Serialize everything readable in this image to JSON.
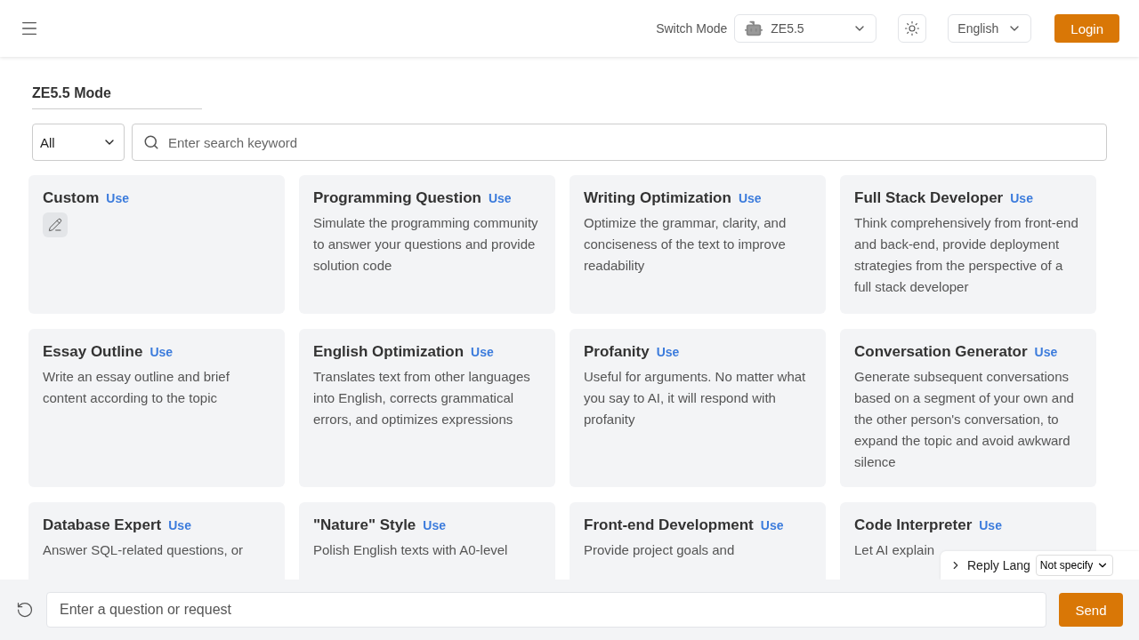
{
  "header": {
    "switch_label": "Switch Mode",
    "mode": "ZE5.5",
    "language": "English",
    "login": "Login"
  },
  "page_title": "ZE5.5 Mode",
  "filter": {
    "category": "All",
    "search_placeholder": "Enter search keyword"
  },
  "cards": [
    {
      "kind": "custom",
      "title": "Custom",
      "action": "Use"
    },
    {
      "kind": "prompt",
      "title": "Programming Question",
      "action": "Use",
      "description": "Simulate the programming community to answer your questions and provide solution code"
    },
    {
      "kind": "prompt",
      "title": "Writing Optimization",
      "action": "Use",
      "description": "Optimize the grammar, clarity, and conciseness of the text to improve readability"
    },
    {
      "kind": "prompt",
      "title": "Full Stack Developer",
      "action": "Use",
      "description": "Think comprehensively from front-end and back-end, provide deployment strategies from the perspective of a full stack developer"
    },
    {
      "kind": "prompt",
      "title": "Essay Outline",
      "action": "Use",
      "description": "Write an essay outline and brief content according to the topic"
    },
    {
      "kind": "prompt",
      "title": "English Optimization",
      "action": "Use",
      "description": "Translates text from other languages into English, corrects grammatical errors, and optimizes expressions"
    },
    {
      "kind": "prompt",
      "title": "Profanity",
      "action": "Use",
      "description": "Useful for arguments. No matter what you say to AI, it will respond with profanity"
    },
    {
      "kind": "prompt",
      "title": "Conversation Generator",
      "action": "Use",
      "description": "Generate subsequent conversations based on a segment of your own and the other person's conversation, to expand the topic and avoid awkward silence"
    },
    {
      "kind": "prompt",
      "title": "Database Expert",
      "action": "Use",
      "description": "Answer SQL-related questions, or"
    },
    {
      "kind": "prompt",
      "title": "\"Nature\" Style",
      "action": "Use",
      "description": "Polish English texts with A0-level"
    },
    {
      "kind": "prompt",
      "title": "Front-end Development",
      "action": "Use",
      "description": "Provide project goals and"
    },
    {
      "kind": "prompt",
      "title": "Code Interpreter",
      "action": "Use",
      "description": "Let AI explain"
    }
  ],
  "reply_lang": {
    "label": "Reply Lang",
    "value": "Not specify"
  },
  "composer": {
    "placeholder": "Enter a question or request",
    "send": "Send"
  }
}
